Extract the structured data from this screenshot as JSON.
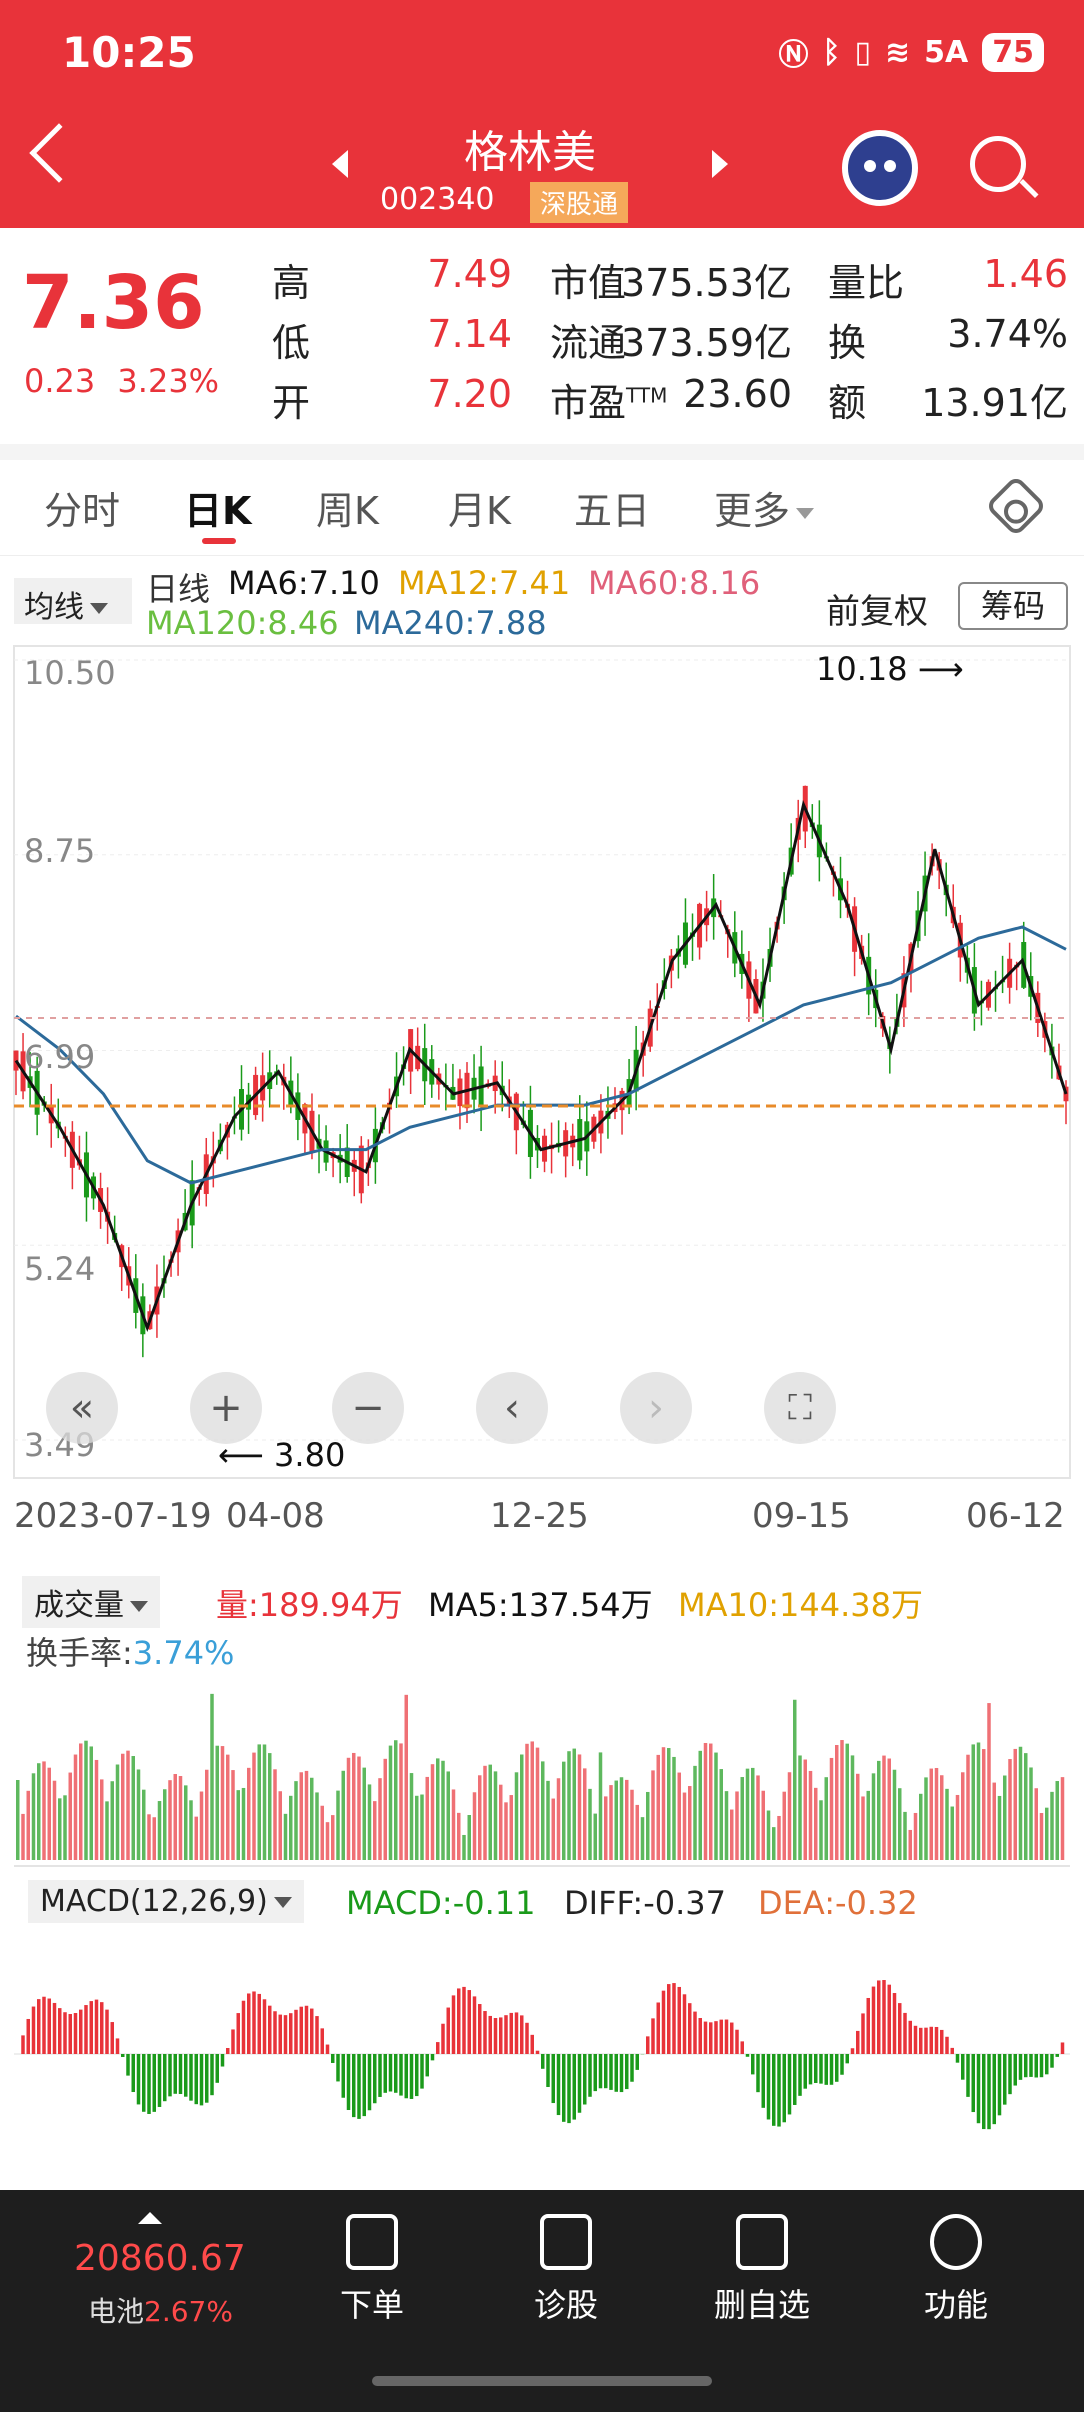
{
  "status_bar": {
    "time": "10:25",
    "signal": "5A",
    "battery": "75"
  },
  "header": {
    "title": "格林美",
    "code": "002340",
    "tag": "深股通"
  },
  "quote": {
    "price": "7.36",
    "change": "0.23",
    "change_pct": "3.23%",
    "rows": [
      {
        "l1": "高",
        "v1": "7.49",
        "l2": "市值",
        "v2": "375.53亿",
        "l3": "量比",
        "v3": "1.46"
      },
      {
        "l1": "低",
        "v1": "7.14",
        "l2": "流通",
        "v2": "373.59亿",
        "l3": "换",
        "v3": "3.74%"
      },
      {
        "l1": "开",
        "v1": "7.20",
        "l2": "市盈",
        "l2sup": "TTM",
        "v2": "23.60",
        "l3": "额",
        "v3": "13.91亿"
      }
    ]
  },
  "tabs": [
    "分时",
    "日K",
    "周K",
    "月K",
    "五日",
    "更多"
  ],
  "ma_bar": {
    "selector": "均线",
    "label": "日线",
    "ma6": "MA6:7.10",
    "ma12": "MA12:7.41",
    "ma60": "MA60:8.16",
    "ma120": "MA120:8.46",
    "ma240": "MA240:7.88",
    "adjust": "前复权",
    "chip_button": "筹码"
  },
  "colors": {
    "up": "#e8333a",
    "down": "#1a9a1a",
    "ma6": "#111111",
    "ma12": "#e0a100",
    "ma60": "#e0607a",
    "ma120": "#6abf40",
    "ma240": "#2c6a9a",
    "header": "#e8333a"
  },
  "chart_data": {
    "type": "line",
    "title": "",
    "y_ticks": [
      "10.50",
      "8.75",
      "6.99",
      "5.24",
      "3.49"
    ],
    "ylim": [
      3.49,
      10.5
    ],
    "x_ticks": [
      "2023-07-19",
      "04-08",
      "12-25",
      "09-15",
      "06-12"
    ],
    "annotations": {
      "high": "10.18",
      "low": "3.80"
    },
    "series": [
      {
        "name": "MA6",
        "values": [
          6.9,
          6.3,
          5.6,
          4.5,
          5.6,
          6.4,
          6.8,
          6.1,
          5.9,
          7.0,
          6.6,
          6.7,
          6.1,
          6.2,
          6.6,
          7.8,
          8.3,
          7.4,
          9.2,
          8.3,
          7.0,
          8.8,
          7.4,
          7.8,
          6.6
        ]
      },
      {
        "name": "MA240",
        "values": [
          7.3,
          7.0,
          6.6,
          6.0,
          5.8,
          5.9,
          6.0,
          6.1,
          6.1,
          6.3,
          6.4,
          6.5,
          6.5,
          6.5,
          6.6,
          6.8,
          7.0,
          7.2,
          7.4,
          7.5,
          7.6,
          7.8,
          8.0,
          8.1,
          7.9
        ]
      }
    ]
  },
  "volume": {
    "selector": "成交量",
    "vol": "量:189.94万",
    "ma5": "MA5:137.54万",
    "ma10": "MA10:144.38万",
    "turnover_label": "换手率:",
    "turnover": "3.74%"
  },
  "macd": {
    "selector": "MACD(12,26,9)",
    "macd": "MACD:-0.11",
    "diff": "DIFF:-0.37",
    "dea": "DEA:-0.32"
  },
  "bottom_nav": {
    "index_value": "20860.67",
    "index_label": "电池",
    "index_pct": "2.67%",
    "items": [
      "下单",
      "诊股",
      "删自选",
      "功能"
    ]
  }
}
